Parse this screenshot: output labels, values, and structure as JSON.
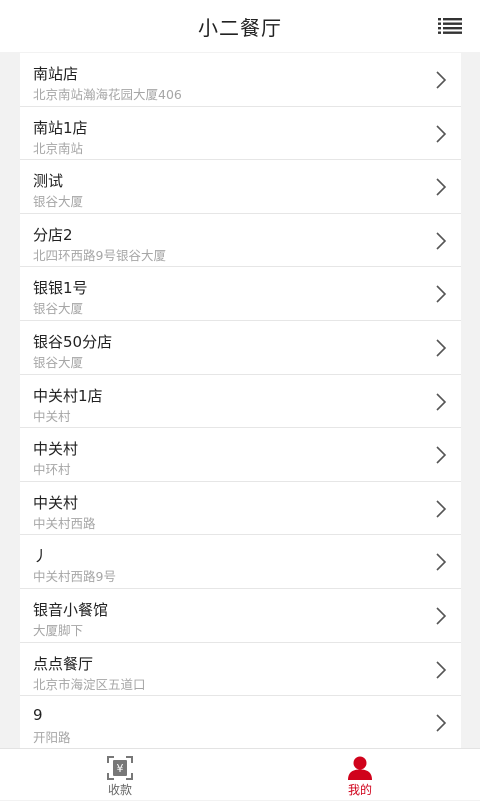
{
  "header": {
    "title": "小二餐厅",
    "menu_icon": "list-menu-icon"
  },
  "restaurants": [
    {
      "name": "南站店",
      "address": "北京南站瀚海花园大厦406"
    },
    {
      "name": "南站1店",
      "address": "北京南站"
    },
    {
      "name": "测试",
      "address": "银谷大厦"
    },
    {
      "name": "分店2",
      "address": "北四环西路9号银谷大厦"
    },
    {
      "name": "银银1号",
      "address": "银谷大厦"
    },
    {
      "name": "银谷50分店",
      "address": "银谷大厦"
    },
    {
      "name": "中关村1店",
      "address": "中关村"
    },
    {
      "name": "中关村",
      "address": "中环村"
    },
    {
      "name": "中关村",
      "address": "中关村西路"
    },
    {
      "name": "丿",
      "address": "中关村西路9号"
    },
    {
      "name": "银音小餐馆",
      "address": "大厦脚下"
    },
    {
      "name": "点点餐厅",
      "address": "北京市海淀区五道口"
    },
    {
      "name": "9",
      "address": "开阳路"
    }
  ],
  "tabbar": {
    "tabs": [
      {
        "label": "收款",
        "icon": "scan-yuan-icon",
        "active": false
      },
      {
        "label": "我的",
        "icon": "user-icon",
        "active": true
      }
    ]
  },
  "colors": {
    "accent": "#d0021b",
    "inactive": "#666666",
    "background": "#f2f2f2"
  }
}
